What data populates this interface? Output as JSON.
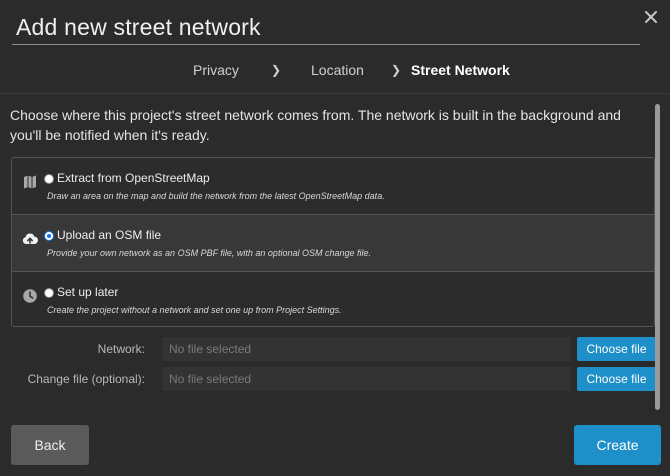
{
  "dialog": {
    "title": "Add new street network",
    "close_icon": "close-icon"
  },
  "steps": [
    {
      "label": "Privacy",
      "active": false
    },
    {
      "label": "Location",
      "active": false
    },
    {
      "label": "Street Network",
      "active": true
    }
  ],
  "description": "Choose where this project's street network comes from. The network is built in the background and you'll be notified when it's ready.",
  "options": [
    {
      "label": "Extract from OpenStreetMap",
      "help": "Draw an area on the map and build the network from the latest OpenStreetMap data.",
      "icon": "map-icon",
      "selected": false
    },
    {
      "label": "Upload an OSM file",
      "help": "Provide your own network as an OSM PBF file, with an optional OSM change file.",
      "icon": "cloud-upload-icon",
      "selected": true
    },
    {
      "label": "Set up later",
      "help": "Create the project without a network and set one up from Project Settings.",
      "icon": "clock-icon",
      "selected": false
    }
  ],
  "file_fields": [
    {
      "label": "Network:",
      "placeholder": "No file selected",
      "button": "Choose file"
    },
    {
      "label": "Change file (optional):",
      "placeholder": "No file selected",
      "button": "Choose file"
    }
  ],
  "footer": {
    "back_label": "Back",
    "create_label": "Create"
  },
  "colors": {
    "background": "#2b2b2b",
    "accent": "#1e8fc8",
    "radio_selected": "#1a73e8"
  }
}
